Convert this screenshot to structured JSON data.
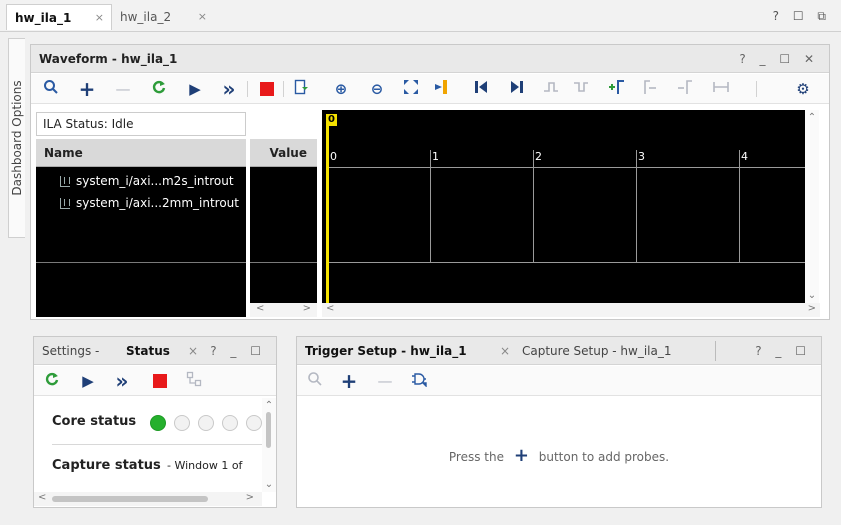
{
  "top_tabs": [
    {
      "label": "hw_ila_1",
      "close": "×"
    },
    {
      "label": "hw_ila_2",
      "close": "×"
    }
  ],
  "window_controls": "? ☐ ⧉",
  "side_tab": "Dashboard Options",
  "waveform": {
    "title": "Waveform - hw_ila_1",
    "controls": "? _ ☐ ✕",
    "ila_status": "ILA Status: Idle",
    "columns": {
      "name": "Name",
      "value": "Value"
    },
    "signals": [
      "system_i/axi...m2s_introut",
      "system_i/axi...2mm_introut"
    ],
    "cursor": "0",
    "ticks": [
      "0",
      "1",
      "2",
      "3",
      "4"
    ]
  },
  "status_panel": {
    "tabs": {
      "settings": "Settings -",
      "status": "Status",
      "close": "×"
    },
    "controls": "? _ ☐",
    "core_status": "Core status",
    "capture_status_label": "Capture status",
    "capture_status_value": "- Window 1 of",
    "leds_on": 1,
    "leds_total": 5
  },
  "trigger_panel": {
    "tabs": {
      "trigger": "Trigger Setup - hw_ila_1",
      "trigger_close": "×",
      "capture": "Capture Setup - hw_ila_1"
    },
    "controls": "? _ ☐",
    "empty_prefix": "Press the",
    "empty_suffix": "button to add probes."
  },
  "icons": {
    "plus": "+",
    "minus": "—",
    "play": "▶",
    "fast_forward": "»",
    "zoom_in": "⊕",
    "zoom_out": "⊖",
    "search": "⚲",
    "gear": "⚙"
  },
  "colors": {
    "accent_blue": "#2a5aa3",
    "run_green": "#2e9c3a",
    "stop_red": "#e8191a",
    "cursor_yellow": "#f5e200",
    "led_green": "#25b02d"
  }
}
